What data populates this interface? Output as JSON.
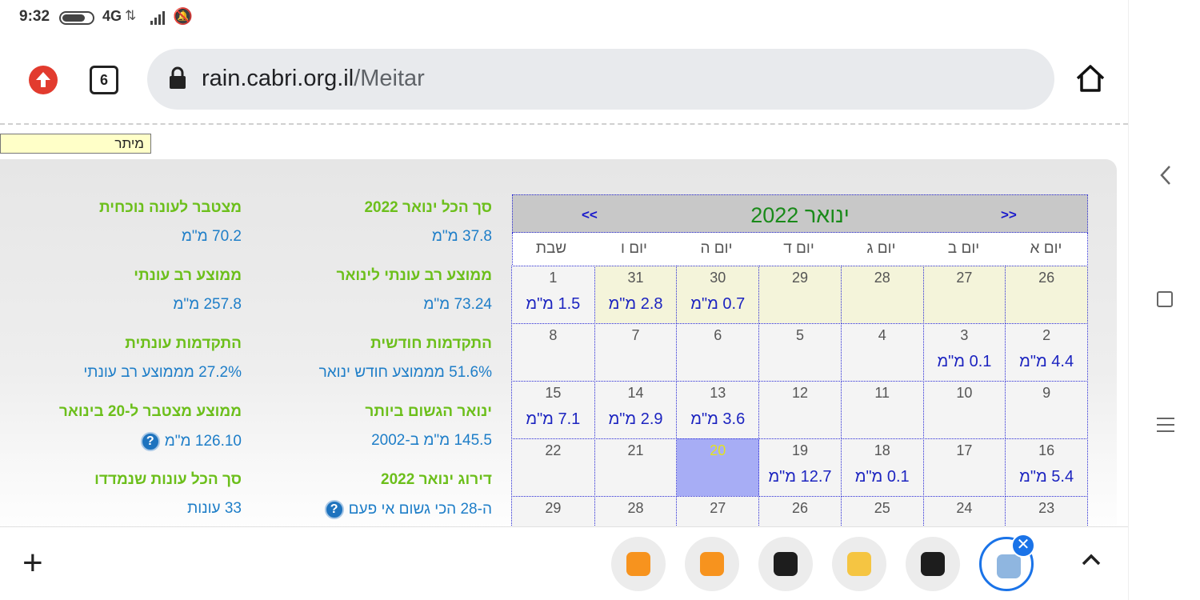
{
  "status_bar": {
    "time": "9:32",
    "network": "4G"
  },
  "browser": {
    "tab_count": "6",
    "url_host": "rain.cabri.org.il",
    "url_path": "/Meitar"
  },
  "location_label": "מיתר",
  "stats_middle": [
    {
      "label": "סך הכל ינואר 2022",
      "value": "37.8 מ\"מ"
    },
    {
      "label": "ממוצע רב עונתי לינואר",
      "value": "73.24 מ\"מ"
    },
    {
      "label": "התקדמות חודשית",
      "value": "51.6% מממוצע חודש ינואר"
    },
    {
      "label": "ינואר הגשום ביותר",
      "value": "145.5 מ\"מ ב-2002"
    },
    {
      "label": "דירוג ינואר 2022",
      "value": "ה-28 הכי גשום אי פעם"
    }
  ],
  "stats_left": [
    {
      "label": "מצטבר לעונה נוכחית",
      "value": "70.2 מ\"מ"
    },
    {
      "label": "ממוצע רב עונתי",
      "value": "257.8 מ\"מ"
    },
    {
      "label": "התקדמות עונתית",
      "value": "27.2% מממוצע רב עונתי"
    },
    {
      "label": "ממוצע מצטבר ל-20 בינואר",
      "value": "126.10 מ\"מ"
    },
    {
      "label": "סך הכל עונות שנמדדו",
      "value": "33 עונות"
    }
  ],
  "help_icon": "?",
  "calendar": {
    "month_title": "ינואר 2022",
    "prev_label": "<<",
    "next_label": ">>",
    "day_headers": [
      "יום א",
      "יום ב",
      "יום ג",
      "יום ד",
      "יום ה",
      "יום ו",
      "שבת"
    ],
    "weeks": [
      [
        {
          "day": "26",
          "rain": "",
          "type": "prev"
        },
        {
          "day": "27",
          "rain": "",
          "type": "prev"
        },
        {
          "day": "28",
          "rain": "",
          "type": "prev"
        },
        {
          "day": "29",
          "rain": "",
          "type": "prev"
        },
        {
          "day": "30",
          "rain": "0.7 מ\"מ",
          "type": "prev"
        },
        {
          "day": "31",
          "rain": "2.8 מ\"מ",
          "type": "prev"
        },
        {
          "day": "1",
          "rain": "1.5 מ\"מ",
          "type": "cur"
        }
      ],
      [
        {
          "day": "2",
          "rain": "4.4 מ\"מ",
          "type": "cur"
        },
        {
          "day": "3",
          "rain": "0.1 מ\"מ",
          "type": "cur"
        },
        {
          "day": "4",
          "rain": "",
          "type": "cur"
        },
        {
          "day": "5",
          "rain": "",
          "type": "cur"
        },
        {
          "day": "6",
          "rain": "",
          "type": "cur"
        },
        {
          "day": "7",
          "rain": "",
          "type": "cur"
        },
        {
          "day": "8",
          "rain": "",
          "type": "cur"
        }
      ],
      [
        {
          "day": "9",
          "rain": "",
          "type": "cur"
        },
        {
          "day": "10",
          "rain": "",
          "type": "cur"
        },
        {
          "day": "11",
          "rain": "",
          "type": "cur"
        },
        {
          "day": "12",
          "rain": "",
          "type": "cur"
        },
        {
          "day": "13",
          "rain": "3.6 מ\"מ",
          "type": "cur"
        },
        {
          "day": "14",
          "rain": "2.9 מ\"מ",
          "type": "cur"
        },
        {
          "day": "15",
          "rain": "7.1 מ\"מ",
          "type": "cur"
        }
      ],
      [
        {
          "day": "16",
          "rain": "5.4 מ\"מ",
          "type": "cur"
        },
        {
          "day": "17",
          "rain": "",
          "type": "cur"
        },
        {
          "day": "18",
          "rain": "0.1 מ\"מ",
          "type": "cur"
        },
        {
          "day": "19",
          "rain": "12.7 מ\"מ",
          "type": "cur"
        },
        {
          "day": "20",
          "rain": "",
          "type": "today"
        },
        {
          "day": "21",
          "rain": "",
          "type": "cur"
        },
        {
          "day": "22",
          "rain": "",
          "type": "cur"
        }
      ],
      [
        {
          "day": "23",
          "rain": "",
          "type": "cur"
        },
        {
          "day": "24",
          "rain": "",
          "type": "cur"
        },
        {
          "day": "25",
          "rain": "",
          "type": "cur"
        },
        {
          "day": "26",
          "rain": "",
          "type": "cur"
        },
        {
          "day": "27",
          "rain": "",
          "type": "cur"
        },
        {
          "day": "28",
          "rain": "",
          "type": "cur"
        },
        {
          "day": "29",
          "rain": "",
          "type": "cur"
        }
      ]
    ]
  },
  "bottom_tabs": [
    {
      "icon": "weather-w-orange-icon",
      "color": "#f7931e"
    },
    {
      "icon": "weather-w-orange-icon",
      "color": "#f7931e"
    },
    {
      "icon": "wu-app-icon",
      "color": "#1d1d1d"
    },
    {
      "icon": "sun-cloud-rain-icon",
      "color": "#f5c542"
    },
    {
      "icon": "wu-app-icon",
      "color": "#1d1d1d"
    },
    {
      "icon": "rain-cloud-icon",
      "color": "#8fb6e0"
    }
  ],
  "colors": {
    "accent_green": "#6cbf1b",
    "value_blue": "#1e7ec8",
    "rain_blue": "#1c24c0",
    "today_highlight": "#a7adf5",
    "prev_month_bg": "#f4f4da",
    "chrome_blue": "#1a73e8"
  }
}
